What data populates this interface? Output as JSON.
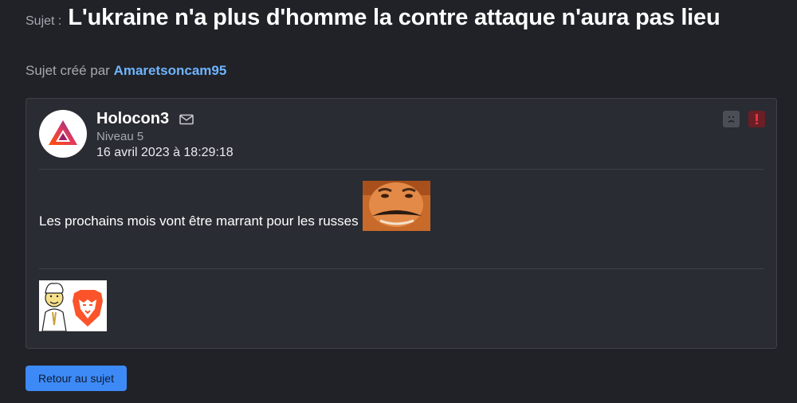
{
  "topic": {
    "prefix": "Sujet :",
    "title": "L'ukraine n'a plus d'homme la contre attaque n'aura pas lieu",
    "created_by_label": "Sujet créé par",
    "created_by_author": "Amaretsoncam95"
  },
  "post": {
    "author": "Holocon3",
    "level": "Niveau 5",
    "date": "16 avril 2023 à 18:29:18",
    "body": "Les prochains mois vont être marrant pour les russes",
    "icons": {
      "avatar": "brave-bat-logo-icon",
      "mail": "envelope-icon",
      "ignore": "sad-face-icon",
      "report": "exclamation-icon",
      "sticker": "risitas-sticker",
      "signature": "brave-lion-signature"
    }
  },
  "actions": {
    "back_label": "Retour au sujet"
  },
  "colors": {
    "background": "#202227",
    "card": "#2a2c33",
    "link": "#6fb4ff",
    "button": "#3d8af7",
    "report": "#6b1e25"
  }
}
